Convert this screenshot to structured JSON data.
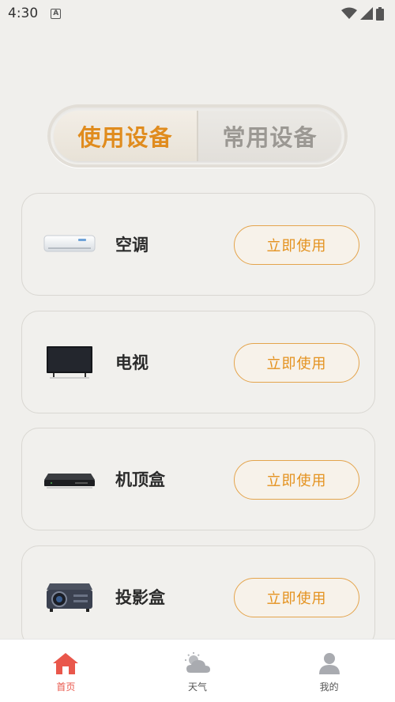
{
  "status_bar": {
    "time": "4:30",
    "notif_letter": "A"
  },
  "tabs": [
    {
      "label": "使用设备",
      "active": true
    },
    {
      "label": "常用设备",
      "active": false
    }
  ],
  "devices": [
    {
      "name": "空调",
      "button": "立即使用",
      "icon": "air-conditioner-icon"
    },
    {
      "name": "电视",
      "button": "立即使用",
      "icon": "tv-icon"
    },
    {
      "name": "机顶盒",
      "button": "立即使用",
      "icon": "set-top-box-icon"
    },
    {
      "name": "投影盒",
      "button": "立即使用",
      "icon": "projector-icon"
    }
  ],
  "bottom_nav": [
    {
      "label": "首页",
      "icon": "home-icon",
      "active": true
    },
    {
      "label": "天气",
      "icon": "weather-icon",
      "active": false
    },
    {
      "label": "我的",
      "icon": "profile-icon",
      "active": false
    }
  ],
  "colors": {
    "accent": "#e08c1e",
    "nav_active": "#e9574b",
    "background": "#f0efec"
  }
}
